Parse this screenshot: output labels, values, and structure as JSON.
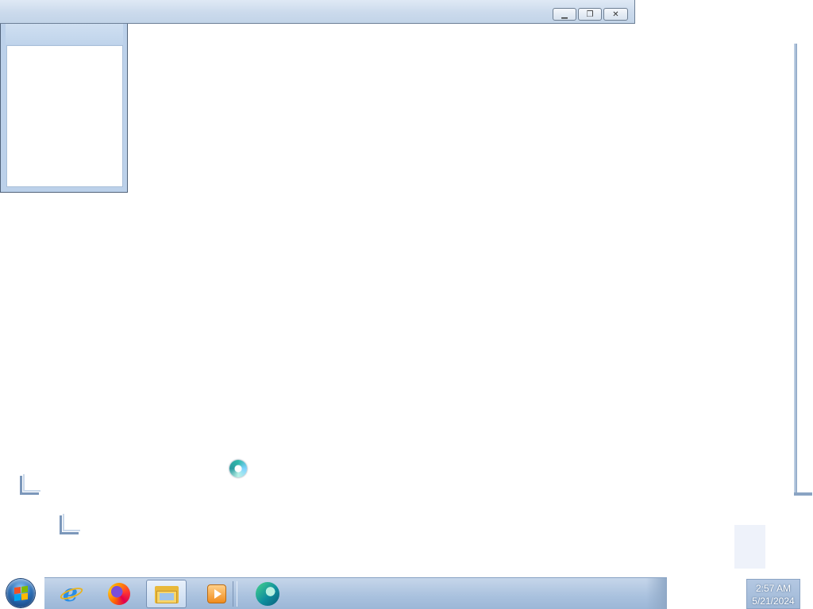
{
  "window": {
    "controls": {
      "minimize_glyph": "▁",
      "restore_glyph": "❐",
      "close_glyph": "✕"
    }
  },
  "taskbar": {
    "pinned": [
      {
        "name": "internet-explorer-icon",
        "active": false
      },
      {
        "name": "firefox-icon",
        "active": false
      },
      {
        "name": "file-explorer-icon",
        "active": true
      },
      {
        "name": "media-player-icon",
        "active": false
      },
      {
        "name": "edge-icon",
        "active": false
      }
    ]
  },
  "tray": {
    "time": "2:57 AM",
    "date": "5/21/2024"
  },
  "colors": {
    "taskbar": "#a9c1de",
    "window_frame": "#cbdaec",
    "accent": "#2b6fb8"
  }
}
